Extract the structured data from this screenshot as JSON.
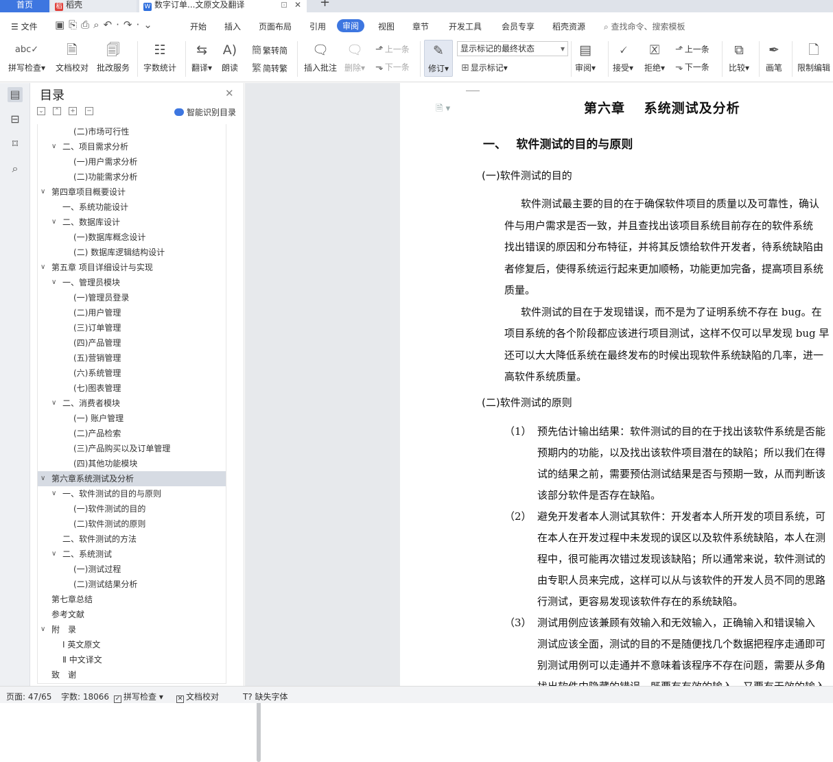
{
  "tabs": {
    "home": "首页",
    "daoke": "稻壳",
    "doc": "数字订单...文原文及翻译",
    "add": "+"
  },
  "menu": {
    "file": "文件",
    "items": [
      "开始",
      "插入",
      "页面布局",
      "引用",
      "审阅",
      "视图",
      "章节",
      "开发工具",
      "会员专享",
      "稻壳资源"
    ],
    "search": "查找命令、搜索模板"
  },
  "toolbar": {
    "spellcheck": "拼写检查",
    "doc_check": "文档校对",
    "batch": "批改服务",
    "wordcount": "字数统计",
    "translate": "翻译",
    "read": "朗读",
    "trad": "繁转简",
    "simp": "简转繁",
    "insert_comment": "插入批注",
    "delete": "删除",
    "prev": "上一条",
    "next": "下一条",
    "revise": "修订",
    "markup_state": "显示标记的最终状态",
    "show_markup": "显示标记",
    "review": "审阅",
    "accept": "接受",
    "reject": "拒绝",
    "prev2": "上一条",
    "next2": "下一条",
    "compare": "比较",
    "pen": "画笔",
    "restrict": "限制编辑"
  },
  "toc": {
    "title": "目录",
    "smart": "智能识别目录",
    "items": [
      "(二)市场可行性",
      "二、项目需求分析",
      "(一)用户需求分析",
      "(二)功能需求分析",
      "第四章项目概要设计",
      "一、系统功能设计",
      "二、数据库设计",
      "(一)数据库概念设计",
      "(二) 数据库逻辑结构设计",
      "第五章 项目详细设计与实现",
      "一、管理员模块",
      "(一)管理员登录",
      "(二)用户管理",
      "(三)订单管理",
      "(四)产品管理",
      "(五)营销管理",
      "(六)系统管理",
      "(七)图表管理",
      "二、消费者模块",
      "(一) 账户管理",
      "(二)产品检索",
      "(三)产品购买以及订单管理",
      "(四)其他功能模块",
      "第六章系统测试及分析",
      "一、软件测试的目的与原则",
      "(一)软件测试的目的",
      "(二)软件测试的原则",
      "二、软件测试的方法",
      "二、系统测试",
      "(一)测试过程",
      "(二)测试结果分析",
      "第七章总结",
      "参考文献",
      "附　录",
      "Ⅰ 英文原文",
      "Ⅱ 中文译文",
      "致　谢"
    ]
  },
  "doc": {
    "chapter": "第六章　 系统测试及分析",
    "sec1": "一、　 软件测试的目的与原则",
    "sub1": "(一)软件测试的目的",
    "p1": [
      "软件测试最主要的目的在于确保软件项目的质量以及可靠性，确认",
      "件与用户需求是否一致，并且查找出该项目系统目前存在的软件系统",
      "找出错误的原因和分布特征，并将其反馈给软件开发者，待系统缺陷由",
      "者修复后，使得系统运行起来更加顺畅，功能更加完备，提高项目系统",
      "质量。"
    ],
    "p2": [
      "软件测试的目在于发现错误，而不是为了证明系统不存在 bug。在",
      "项目系统的各个阶段都应该进行项目测试，这样不仅可以早发现 bug 早",
      "还可以大大降低系统在最终发布的时候出现软件系统缺陷的几率，进一",
      "高软件系统质量。"
    ],
    "sub2": "(二)软件测试的原则",
    "items": [
      {
        "num": "（1）",
        "lines": [
          "预先估计输出结果：软件测试的目的在于找出该软件系统是否能",
          "预期内的功能，以及找出该软件项目潜在的缺陷；所以我们在得",
          "试的结果之前，需要预估测试结果是否与预期一致，从而判断该",
          "该部分软件是否存在缺陷。"
        ]
      },
      {
        "num": "（2）",
        "lines": [
          "避免开发者本人测试其软件：开发者本人所开发的项目系统，可",
          "在本人在开发过程中未发现的误区以及软件系统缺陷，本人在测",
          "程中，很可能再次错过发现该缺陷；所以通常来说，软件测试的",
          "由专职人员来完成，这样可以从与该软件的开发人员不同的思路",
          "行测试，更容易发现该软件存在的系统缺陷。"
        ]
      },
      {
        "num": "（3）",
        "lines": [
          "测试用例应该兼顾有效输入和无效输入，正确输入和错误输入",
          "测试应该全面，测试的目的不是随便找几个数据把程序走通即可",
          "别测试用例可以走通并不意味着该程序不存在问题，需要从多角",
          "找出软件中隐藏的错误，既要有有效的输入，又要有无效的输入"
        ]
      }
    ]
  },
  "status": {
    "page": "页面: 47/65",
    "words": "字数: 18066",
    "spell": "拼写检查",
    "proof": "文档校对",
    "missing_font": "缺失字体"
  }
}
